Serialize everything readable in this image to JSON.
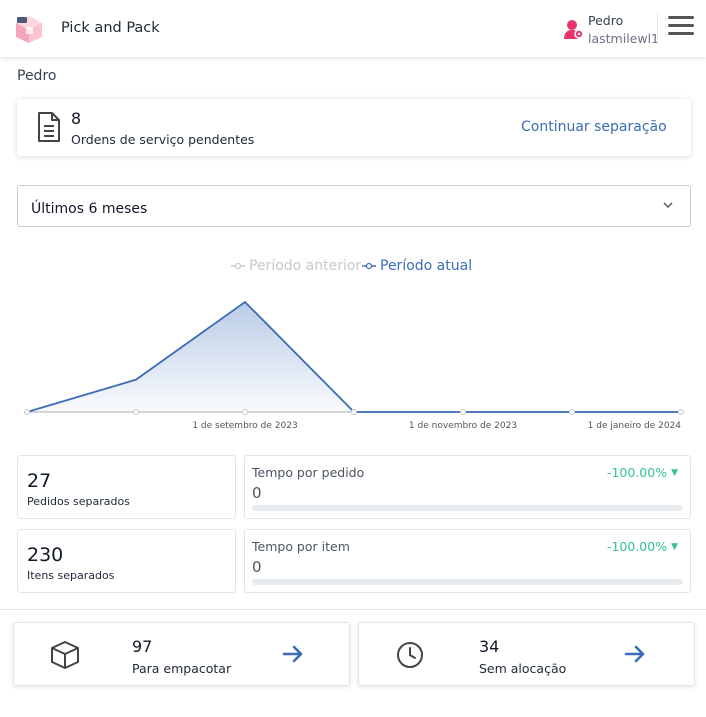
{
  "header": {
    "app_title": "Pick and Pack",
    "user_name": "Pedro",
    "user_login": "lastmilewl1"
  },
  "greeting": "Pedro",
  "pending": {
    "count": "8",
    "label": "Ordens de serviço pendentes",
    "action": "Continuar separação"
  },
  "period_select": {
    "value": "Últimos 6 meses"
  },
  "chart_data": {
    "type": "area",
    "series": [
      {
        "name": "Período anterior",
        "color": "#c9c9c9",
        "values": [
          0,
          0,
          0,
          0,
          0,
          0,
          0
        ]
      },
      {
        "name": "Período atual",
        "color": "#3b6cb7",
        "values": [
          0,
          10,
          34,
          0,
          0,
          0,
          0
        ]
      }
    ],
    "x_labels": [
      "",
      "",
      "1 de setembro de 2023",
      "",
      "1 de novembro de 2023",
      "",
      "1 de janeiro de 2024"
    ],
    "ylim": [
      0,
      34
    ],
    "grid": false,
    "legend_position": "top-center"
  },
  "stats": {
    "orders": {
      "value": "27",
      "label": "Pedidos separados"
    },
    "items": {
      "value": "230",
      "label": "Itens separados"
    },
    "time_per_order": {
      "title": "Tempo por pedido",
      "value": "0",
      "delta": "-100.00%"
    },
    "time_per_item": {
      "title": "Tempo por item",
      "value": "0",
      "delta": "-100.00%"
    }
  },
  "actions": {
    "pack": {
      "count": "97",
      "label": "Para empacotar",
      "icon": "box-icon"
    },
    "unallocated": {
      "count": "34",
      "label": "Sem alocação",
      "icon": "clock-icon"
    }
  },
  "colors": {
    "accent": "#3b6cb7",
    "positive": "#34c38f",
    "user_icon": "#e8336b"
  }
}
